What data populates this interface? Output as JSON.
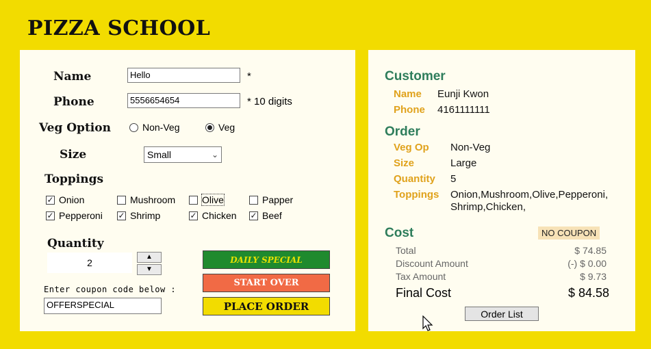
{
  "app": {
    "title": "PIZZA SCHOOL"
  },
  "form": {
    "name_label": "Name",
    "name_value": "Hello",
    "name_note": "*",
    "phone_label": "Phone",
    "phone_value": "5556654654",
    "phone_note": "* 10 digits",
    "veg_label": "Veg Option",
    "veg_options": [
      {
        "label": "Non-Veg",
        "checked": false
      },
      {
        "label": "Veg",
        "checked": true
      }
    ],
    "size_label": "Size",
    "size_value": "Small",
    "toppings_label": "Toppings",
    "toppings": [
      {
        "label": "Onion",
        "checked": true
      },
      {
        "label": "Mushroom",
        "checked": false
      },
      {
        "label": "Olive",
        "checked": false
      },
      {
        "label": "Papper",
        "checked": false
      },
      {
        "label": "Pepperoni",
        "checked": true
      },
      {
        "label": "Shrimp",
        "checked": true
      },
      {
        "label": "Chicken",
        "checked": true
      },
      {
        "label": "Beef",
        "checked": true
      }
    ],
    "quantity_label": "Quantity",
    "quantity_value": "2",
    "coupon_prompt": "Enter coupon code below :",
    "coupon_value": "OFFERSPECIAL",
    "buttons": {
      "daily_special": "DAILY SPECIAL",
      "start_over": "START OVER",
      "place_order": "PLACE ORDER"
    }
  },
  "summary": {
    "customer_heading": "Customer",
    "name_label": "Name",
    "name_value": "Eunji Kwon",
    "phone_label": "Phone",
    "phone_value": "4161111111",
    "order_heading": "Order",
    "vegop_label": "Veg Op",
    "vegop_value": "Non-Veg",
    "size_label": "Size",
    "size_value": "Large",
    "quantity_label": "Quantity",
    "quantity_value": "5",
    "toppings_label": "Toppings",
    "toppings_line1": "Onion,Mushroom,Olive,Pepperoni,",
    "toppings_line2": "Shrimp,Chicken,",
    "cost_heading": "Cost",
    "coupon_badge": "NO COUPON",
    "total_label": "Total",
    "total_value": "$ 74.85",
    "discount_label": "Discount Amount",
    "discount_value": "(-) $ 0.00",
    "tax_label": "Tax Amount",
    "tax_value": "$ 9.73",
    "final_label": "Final Cost",
    "final_value": "$ 84.58",
    "order_list_button": "Order List"
  },
  "colors": {
    "background": "#f2dc00",
    "heading_green": "#2e7d5b",
    "label_orange": "#e0a21c",
    "daily_special_bg": "#1f8a2e",
    "start_over_bg": "#f16a45",
    "place_order_bg": "#f2dc00"
  }
}
